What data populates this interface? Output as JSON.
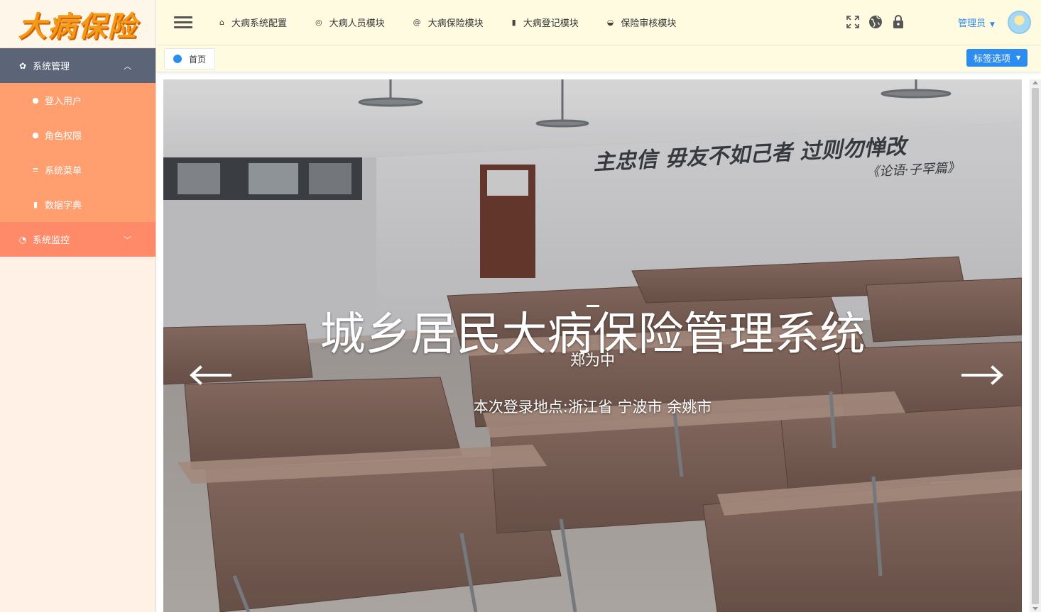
{
  "logo": {
    "text": "大病保险"
  },
  "sidebar": {
    "groups": [
      {
        "label": "系统管理",
        "icon": "gear-icon",
        "expanded": true,
        "items": [
          {
            "label": "登入用户",
            "icon": "user-icon"
          },
          {
            "label": "角色权限",
            "icon": "users-icon"
          },
          {
            "label": "系统菜单",
            "icon": "list-icon"
          },
          {
            "label": "数据字典",
            "icon": "book-icon"
          }
        ]
      },
      {
        "label": "系统监控",
        "icon": "gauge-icon",
        "expanded": false
      }
    ]
  },
  "header": {
    "nav": [
      {
        "label": "大病系统配置",
        "icon": "home-icon"
      },
      {
        "label": "大病人员模块",
        "icon": "globe-icon"
      },
      {
        "label": "大病保险模块",
        "icon": "at-icon"
      },
      {
        "label": "大病登记模块",
        "icon": "book-icon"
      },
      {
        "label": "保险审核模块",
        "icon": "circle-icon"
      }
    ],
    "icons": [
      "fullscreen-icon",
      "globe-icon",
      "lock-icon"
    ],
    "user": "管理员"
  },
  "tabs": {
    "home": "首页",
    "options_button": "标签选项"
  },
  "banner": {
    "title": "城乡居民大病保险管理系统",
    "name": "郑为中",
    "location": "本次登录地点:浙江省 宁波市 余姚市",
    "wall_quote": "主忠信 毋友不如己者 过则勿惮改",
    "wall_source": "《论语·子罕篇》"
  },
  "colors": {
    "sidebar_bg": "#fff1e6",
    "menu_head": "#5c6478",
    "submenu": "#ff9e6e",
    "monitor": "#ff8a6a",
    "header_bg": "#fffbe0",
    "accent": "#2d8cf0"
  }
}
